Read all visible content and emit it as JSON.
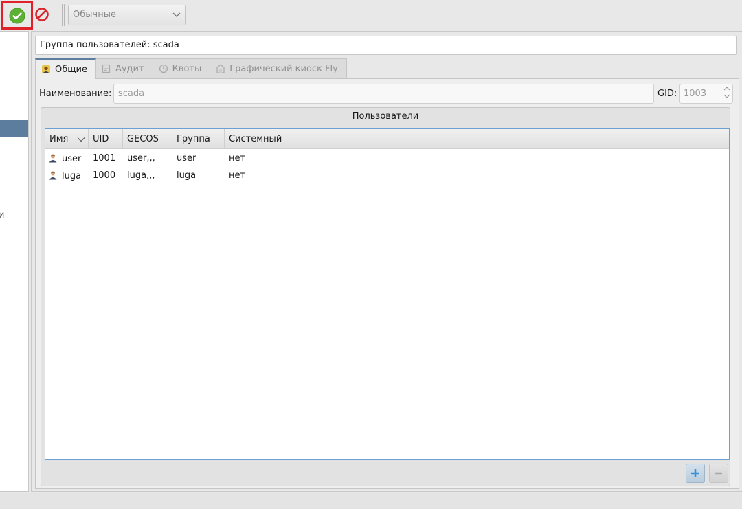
{
  "toolbar": {
    "apply_icon": "checkmark-circle-icon",
    "cancel_icon": "forbidden-icon",
    "mode_select": "Обычные",
    "colors": {
      "apply_green": "#5cb135",
      "cancel_red": "#d8262e",
      "highlight": "#e0212a"
    }
  },
  "left_panel": {
    "stub_text": "и"
  },
  "group": {
    "title": "Группа пользователей: scada"
  },
  "tabs": [
    {
      "label": "Общие",
      "icon": "group-icon"
    },
    {
      "label": "Аудит",
      "icon": "audit-icon"
    },
    {
      "label": "Квоты",
      "icon": "quota-icon"
    },
    {
      "label": "Графический киоск Fly",
      "icon": "kiosk-icon"
    }
  ],
  "general": {
    "name_label": "Наименование:",
    "name_value": "scada",
    "gid_label": "GID:",
    "gid_value": "1003"
  },
  "users": {
    "title": "Пользователи",
    "columns": [
      "Имя",
      "UID",
      "GECOS",
      "Группа",
      "Системный"
    ],
    "rows": [
      {
        "name": "user",
        "uid": "1001",
        "gecos": "user,,,",
        "group": "user",
        "system": "нет"
      },
      {
        "name": "luga",
        "uid": "1000",
        "gecos": "luga,,,",
        "group": "luga",
        "system": "нет"
      }
    ],
    "add_icon": "plus-icon",
    "remove_icon": "minus-icon"
  }
}
